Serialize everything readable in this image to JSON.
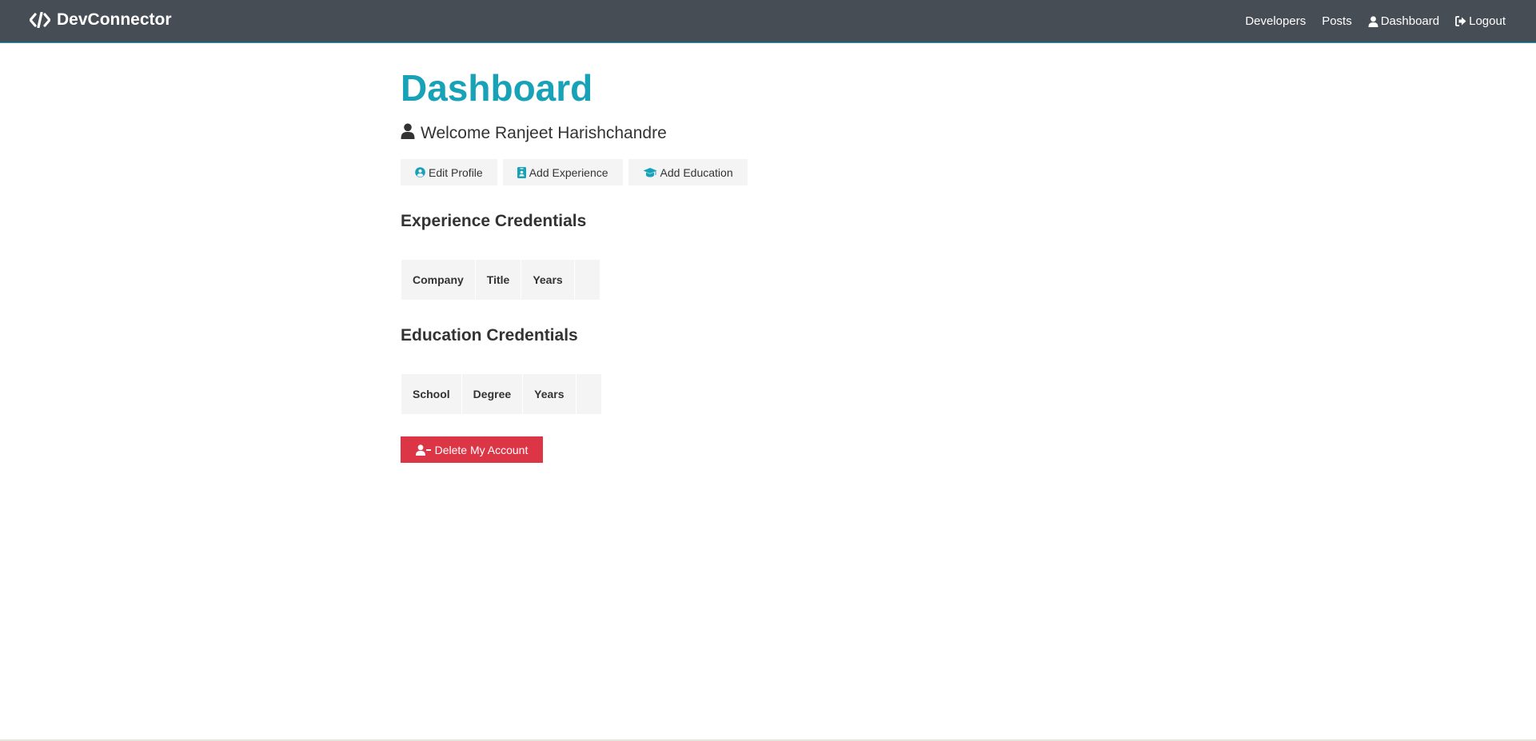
{
  "navbar": {
    "brand": "DevConnector",
    "links": {
      "developers": "Developers",
      "posts": "Posts",
      "dashboard": "Dashboard",
      "logout": "Logout"
    }
  },
  "main": {
    "title": "Dashboard",
    "welcome": "Welcome Ranjeet Harishchandre",
    "buttons": {
      "edit_profile": "Edit Profile",
      "add_experience": "Add Experience",
      "add_education": "Add Education"
    },
    "experience": {
      "heading": "Experience Credentials",
      "columns": [
        "Company",
        "Title",
        "Years",
        ""
      ]
    },
    "education": {
      "heading": "Education Credentials",
      "columns": [
        "School",
        "Degree",
        "Years",
        ""
      ]
    },
    "delete_account": "Delete My Account"
  },
  "colors": {
    "navbar": "#474d54",
    "primary": "#17a2b8",
    "danger": "#dc3545",
    "light": "#f4f4f4"
  },
  "icons": {
    "brand": "code-icon",
    "dashboard": "user-icon",
    "logout": "sign-out-icon",
    "welcome": "user-icon",
    "edit_profile": "user-circle-icon",
    "add_experience": "id-badge-icon",
    "add_education": "graduation-cap-icon",
    "delete_account": "user-minus-icon"
  }
}
